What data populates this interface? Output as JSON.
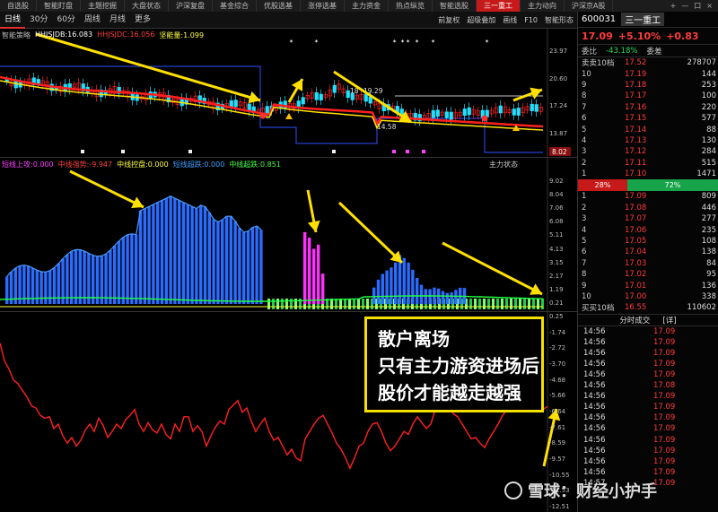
{
  "tabs": [
    "自选股",
    "智能盯盘",
    "主题挖掘",
    "大盘状态",
    "沪深复盘",
    "基金综合",
    "优股选基",
    "涨停选基",
    "主力资金",
    "热点纵览",
    "智能选股",
    "三一重工",
    "主力动向",
    "沪深京A股"
  ],
  "active_tab": 11,
  "window_controls": [
    "+",
    "—",
    "口",
    "×"
  ],
  "toolbar": {
    "periods": [
      "日线",
      "30分",
      "60分",
      "周线",
      "月线",
      "更多"
    ],
    "tools": [
      "前复权",
      "超级叠加",
      "画线",
      "F10",
      "智能形态"
    ]
  },
  "kline_panel": {
    "legend": [
      {
        "text": "智能策略",
        "color": "#bbbbbb"
      },
      {
        "text": "HHJSJDB:16.083",
        "color": "#ffffff"
      },
      {
        "text": "HHJSJDC:16.056",
        "color": "#ff4040"
      },
      {
        "text": "坚能量:1.099",
        "color": "#ffff40"
      }
    ],
    "y_labels": [
      "23.97",
      "20.60",
      "17.24",
      "13.87"
    ],
    "price_tag": "8.02",
    "annotations": [
      "18",
      "19.29",
      "14.58"
    ],
    "colors": {
      "up": "#ff2020",
      "down": "#20e0ff",
      "ma_red": "#ff2020",
      "ma_yellow": "#ffe000",
      "resistance": "#3050ff"
    }
  },
  "flow_panel": {
    "legend": [
      {
        "text": "短线上攻:0.000",
        "color": "#ff40ff"
      },
      {
        "text": "中线强势:-9.947",
        "color": "#ff4040"
      },
      {
        "text": "中线控盘:0.000",
        "color": "#ffff40"
      },
      {
        "text": "短线超跌:0.000",
        "color": "#40a0ff"
      },
      {
        "text": "中线超跌:0.851",
        "color": "#40ff40"
      }
    ],
    "title": "主力状态",
    "y_labels": [
      "9.02",
      "8.04",
      "7.06",
      "6.08",
      "5.11",
      "4.13",
      "3.15",
      "2.17",
      "1.19",
      "0.21"
    ]
  },
  "line_panel": {
    "y_labels": [
      "0.25",
      "-1.74",
      "-2.72",
      "-3.70",
      "-4.68",
      "-5.66",
      "-6.64",
      "-7.61",
      "-8.59",
      "-9.57",
      "-10.55",
      "-11.53",
      "-12.51"
    ],
    "color": "#ff2020"
  },
  "annotation_box": {
    "lines": [
      "散户离场",
      "只有主力游资进场后",
      "股价才能越走越强"
    ],
    "border_color": "#f4e000"
  },
  "right_panel": {
    "code": "600031",
    "name": "三一重工",
    "price": "17.09",
    "change_pct": "+5.10%",
    "change": "+0.83",
    "weibi_label": "委比",
    "weibi_value": "-43.18%",
    "weicha_label": "委差",
    "sell_header": {
      "label": "卖卖10档",
      "price": "17.52",
      "vol": "278707"
    },
    "sell_rows": [
      {
        "level": "10",
        "price": "17.19",
        "vol": "144"
      },
      {
        "level": "9",
        "price": "17.18",
        "vol": "253"
      },
      {
        "level": "8",
        "price": "17.17",
        "vol": "100"
      },
      {
        "level": "7",
        "price": "17.16",
        "vol": "220"
      },
      {
        "level": "6",
        "price": "17.15",
        "vol": "577"
      },
      {
        "level": "5",
        "price": "17.14",
        "vol": "88"
      },
      {
        "level": "4",
        "price": "17.13",
        "vol": "130"
      },
      {
        "level": "3",
        "price": "17.12",
        "vol": "284"
      },
      {
        "level": "2",
        "price": "17.11",
        "vol": "515"
      },
      {
        "level": "1",
        "price": "17.10",
        "vol": "1471"
      }
    ],
    "ratio": {
      "buy": "28%",
      "sell": "72%"
    },
    "buy_rows": [
      {
        "level": "1",
        "price": "17.09",
        "vol": "809"
      },
      {
        "level": "2",
        "price": "17.08",
        "vol": "446"
      },
      {
        "level": "3",
        "price": "17.07",
        "vol": "277"
      },
      {
        "level": "4",
        "price": "17.06",
        "vol": "235"
      },
      {
        "level": "5",
        "price": "17.05",
        "vol": "108"
      },
      {
        "level": "6",
        "price": "17.04",
        "vol": "138"
      },
      {
        "level": "7",
        "price": "17.03",
        "vol": "84"
      },
      {
        "level": "8",
        "price": "17.02",
        "vol": "95"
      },
      {
        "level": "9",
        "price": "17.01",
        "vol": "136"
      },
      {
        "level": "10",
        "price": "17.00",
        "vol": "338"
      }
    ],
    "buy_footer": {
      "label": "买买10档",
      "price": "16.55",
      "vol": "110602"
    },
    "ticks_header": {
      "label": "分时成交",
      "detail": "[详]"
    },
    "ticks": [
      {
        "time": "14:56",
        "price": "17.09"
      },
      {
        "time": "14:56",
        "price": "17.09"
      },
      {
        "time": "14:56",
        "price": "17.09"
      },
      {
        "time": "14:56",
        "price": "17.09"
      },
      {
        "time": "14:56",
        "price": "17.09"
      },
      {
        "time": "14:56",
        "price": "17.08"
      },
      {
        "time": "14:56",
        "price": "17.09"
      },
      {
        "time": "14:56",
        "price": "17.09"
      },
      {
        "time": "14:56",
        "price": "17.09"
      },
      {
        "time": "14:56",
        "price": "17.09"
      },
      {
        "time": "14:56",
        "price": "17.09"
      },
      {
        "time": "14:56",
        "price": "17.09"
      },
      {
        "time": "14:56",
        "price": "17.09"
      },
      {
        "time": "14:56",
        "price": "17.09"
      },
      {
        "time": "14:57",
        "price": "17.09"
      }
    ]
  },
  "watermark": "雪球：财经小护手"
}
